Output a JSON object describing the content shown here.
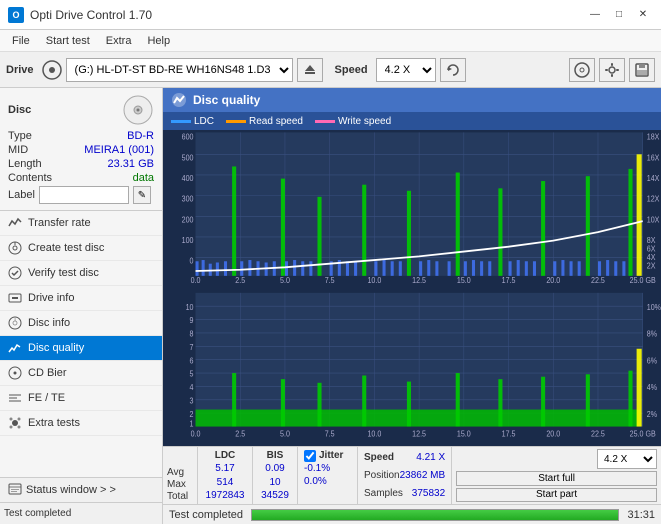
{
  "titlebar": {
    "title": "Opti Drive Control 1.70",
    "icon": "ODC",
    "controls": {
      "minimize": "—",
      "maximize": "□",
      "close": "✕"
    }
  },
  "menubar": {
    "items": [
      "File",
      "Start test",
      "Extra",
      "Help"
    ]
  },
  "toolbar": {
    "drive_label": "Drive",
    "drive_value": "(G:)  HL-DT-ST BD-RE  WH16NS48 1.D3",
    "speed_label": "Speed",
    "speed_value": "4.2 X"
  },
  "disc_panel": {
    "title": "Disc",
    "type_label": "Type",
    "type_value": "BD-R",
    "mid_label": "MID",
    "mid_value": "MEIRA1 (001)",
    "length_label": "Length",
    "length_value": "23.31 GB",
    "contents_label": "Contents",
    "contents_value": "data",
    "label_label": "Label",
    "label_value": ""
  },
  "nav_items": [
    {
      "id": "transfer-rate",
      "label": "Transfer rate",
      "icon": "chart"
    },
    {
      "id": "create-test-disc",
      "label": "Create test disc",
      "icon": "disc"
    },
    {
      "id": "verify-test-disc",
      "label": "Verify test disc",
      "icon": "check"
    },
    {
      "id": "drive-info",
      "label": "Drive info",
      "icon": "info"
    },
    {
      "id": "disc-info",
      "label": "Disc info",
      "icon": "disc-info"
    },
    {
      "id": "disc-quality",
      "label": "Disc quality",
      "icon": "quality",
      "active": true
    },
    {
      "id": "cd-bier",
      "label": "CD Bier",
      "icon": "cd"
    },
    {
      "id": "fe-te",
      "label": "FE / TE",
      "icon": "fe"
    },
    {
      "id": "extra-tests",
      "label": "Extra tests",
      "icon": "extra"
    }
  ],
  "status_window": {
    "label": "Status window > >"
  },
  "chart": {
    "title": "Disc quality",
    "legend": {
      "ldc": "LDC",
      "read_speed": "Read speed",
      "write_speed": "Write speed"
    },
    "upper": {
      "y_max": 600,
      "y_labels": [
        "600",
        "500",
        "400",
        "300",
        "200",
        "100",
        "0"
      ],
      "y_labels_right": [
        "18X",
        "16X",
        "14X",
        "12X",
        "10X",
        "8X",
        "6X",
        "4X",
        "2X"
      ],
      "x_labels": [
        "0.0",
        "2.5",
        "5.0",
        "7.5",
        "10.0",
        "12.5",
        "15.0",
        "17.5",
        "20.0",
        "22.5",
        "25.0 GB"
      ]
    },
    "lower": {
      "y_max": 10,
      "y_labels": [
        "10",
        "9",
        "8",
        "7",
        "6",
        "5",
        "4",
        "3",
        "2",
        "1"
      ],
      "y_labels_right": [
        "10%",
        "8%",
        "6%",
        "4%",
        "2%"
      ],
      "x_labels": [
        "0.0",
        "2.5",
        "5.0",
        "7.5",
        "10.0",
        "12.5",
        "15.0",
        "17.5",
        "20.0",
        "22.5",
        "25.0 GB"
      ],
      "bis_label": "BIS",
      "jitter_label": "Jitter"
    }
  },
  "stats": {
    "headers": [
      "LDC",
      "BIS",
      "",
      "Jitter",
      "Speed",
      ""
    ],
    "avg_label": "Avg",
    "max_label": "Max",
    "total_label": "Total",
    "ldc_avg": "5.17",
    "ldc_max": "514",
    "ldc_total": "1972843",
    "bis_avg": "0.09",
    "bis_max": "10",
    "bis_total": "34529",
    "jitter_checked": true,
    "jitter_avg": "-0.1%",
    "jitter_max": "0.0%",
    "speed_label": "Speed",
    "speed_value": "4.21 X",
    "position_label": "Position",
    "position_value": "23862 MB",
    "samples_label": "Samples",
    "samples_value": "375832",
    "speed_select": "4.2 X",
    "btn_start_full": "Start full",
    "btn_start_part": "Start part"
  },
  "bottom_bar": {
    "status": "Test completed",
    "progress": 100,
    "time": "31:31"
  }
}
